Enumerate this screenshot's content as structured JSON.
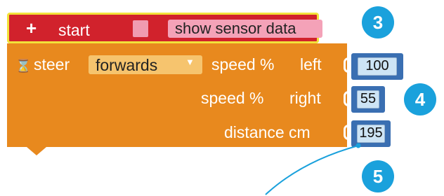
{
  "start_block": {
    "plus_icon": "+",
    "label": "start",
    "show_sensor_label": "show sensor data"
  },
  "steer_block": {
    "hourglass_icon": "⌛",
    "label": "steer",
    "direction": "forwards",
    "dropdown_arrow": "▼",
    "speed_left_label": "speed %",
    "left_label": "left",
    "speed_right_label": "speed %",
    "right_label": "right",
    "distance_label": "distance cm"
  },
  "values": {
    "speed_left": "100",
    "speed_right": "55",
    "distance": "195"
  },
  "badges": {
    "b3": "3",
    "b4": "4",
    "b5": "5"
  },
  "colors": {
    "start_block": "#d1222c",
    "start_outline": "#f2e23a",
    "steer_block": "#e8891e",
    "dropdown": "#f6c46e",
    "number_block": "#3a6fb2",
    "number_field": "#cde4f5",
    "badge": "#1aa1dc"
  }
}
